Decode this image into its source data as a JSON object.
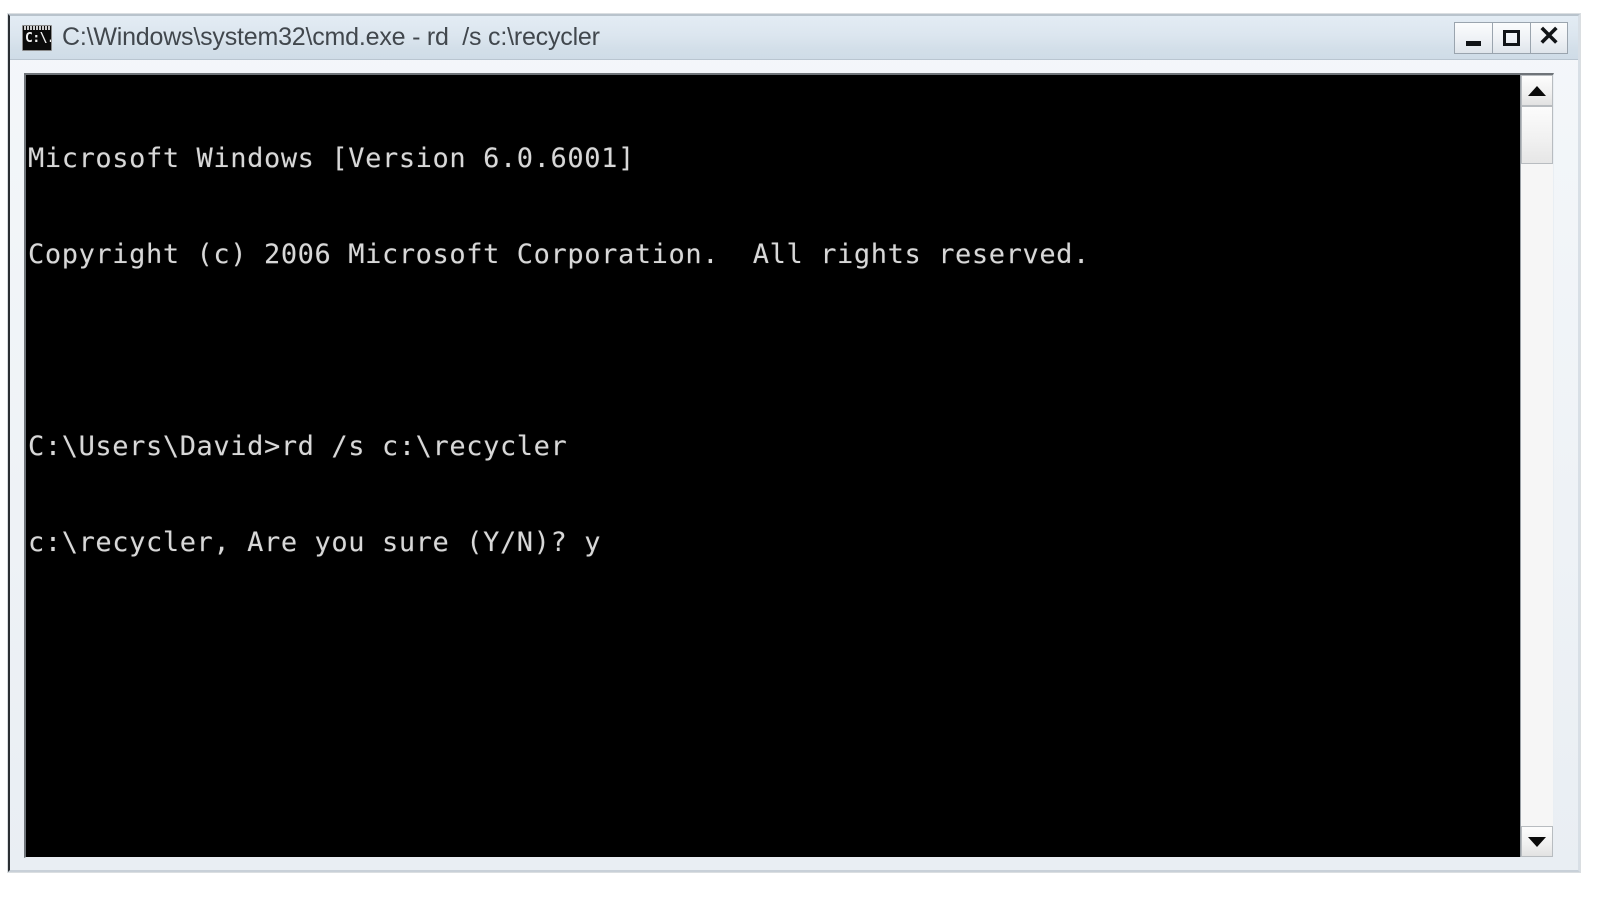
{
  "window": {
    "title": "C:\\Windows\\system32\\cmd.exe - rd  /s c:\\recycler",
    "icon_name": "cmd-prompt-icon",
    "icon_text": "C:\\.",
    "colors": {
      "titlebar": "#dce6ef",
      "title_text": "#41474d",
      "console_background": "#000000",
      "console_text": "#d8d8d8",
      "frame": "#e9eef3"
    },
    "caption_buttons": [
      {
        "name": "minimize-button",
        "label": "Minimize"
      },
      {
        "name": "maximize-button",
        "label": "Maximize"
      },
      {
        "name": "close-button",
        "label": "Close",
        "glyph": "✕"
      }
    ]
  },
  "console": {
    "lines": [
      "Microsoft Windows [Version 6.0.6001]",
      "Copyright (c) 2006 Microsoft Corporation.  All rights reserved.",
      "",
      "C:\\Users\\David>rd /s c:\\recycler",
      "c:\\recycler, Are you sure (Y/N)? y"
    ]
  },
  "scrollbar": {
    "up_arrow": "▲",
    "down_arrow": "▼",
    "thumb_position": "top"
  }
}
